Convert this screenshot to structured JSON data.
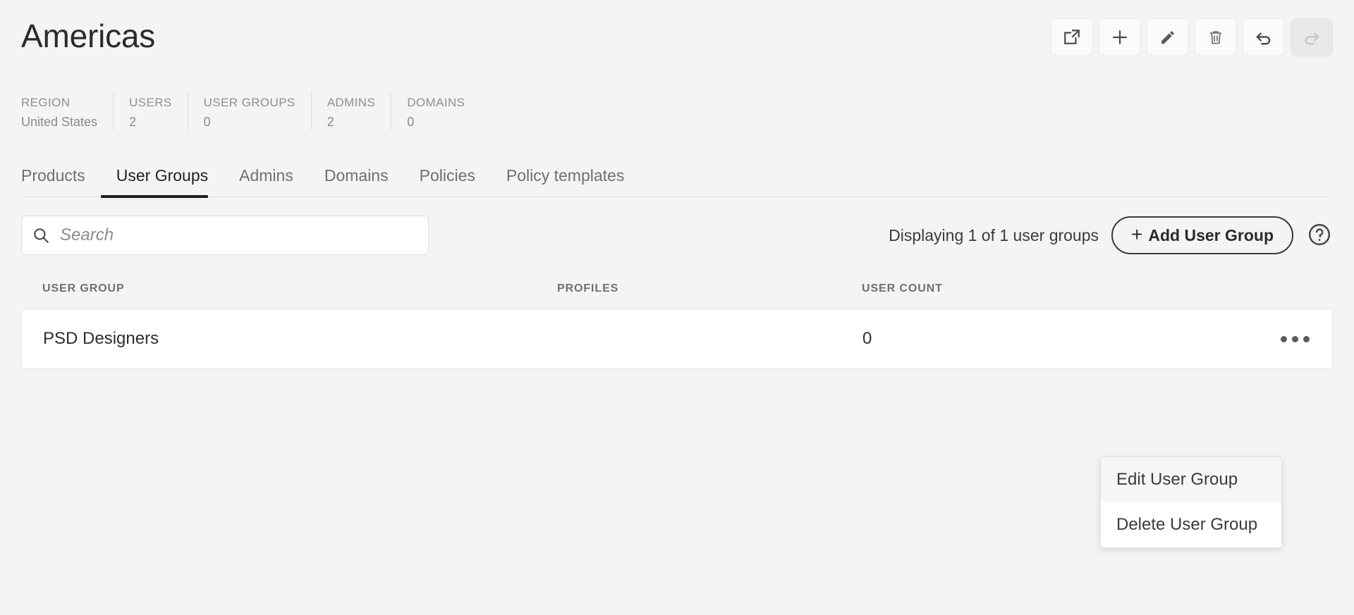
{
  "header": {
    "title": "Americas",
    "toolbar": [
      {
        "name": "open-external-button",
        "icon": "external-link-icon",
        "disabled": false
      },
      {
        "name": "add-button",
        "icon": "plus-icon",
        "disabled": false
      },
      {
        "name": "edit-button",
        "icon": "pencil-icon",
        "disabled": false
      },
      {
        "name": "delete-button",
        "icon": "trash-icon",
        "disabled": false
      },
      {
        "name": "undo-button",
        "icon": "undo-arrow-icon",
        "disabled": false
      },
      {
        "name": "redo-button",
        "icon": "redo-arrow-icon",
        "disabled": true
      }
    ]
  },
  "stats": [
    {
      "label": "REGION",
      "value": "United States"
    },
    {
      "label": "USERS",
      "value": "2"
    },
    {
      "label": "USER GROUPS",
      "value": "0"
    },
    {
      "label": "ADMINS",
      "value": "2"
    },
    {
      "label": "DOMAINS",
      "value": "0"
    }
  ],
  "tabs": [
    {
      "label": "Products",
      "active": false
    },
    {
      "label": "User Groups",
      "active": true
    },
    {
      "label": "Admins",
      "active": false
    },
    {
      "label": "Domains",
      "active": false
    },
    {
      "label": "Policies",
      "active": false
    },
    {
      "label": "Policy templates",
      "active": false
    }
  ],
  "list_toolbar": {
    "search_placeholder": "Search",
    "search_value": "",
    "display_count": "Displaying 1 of 1 user groups",
    "add_button_label": "Add User Group",
    "add_button_plus": "+",
    "help_label": "?"
  },
  "table": {
    "columns": [
      "USER GROUP",
      "PROFILES",
      "USER COUNT"
    ],
    "rows": [
      {
        "user_group": "PSD Designers",
        "profiles": "",
        "user_count": "0"
      }
    ]
  },
  "context_menu": {
    "items": [
      {
        "label": "Edit User Group",
        "highlighted": true
      },
      {
        "label": "Delete User Group",
        "highlighted": false
      }
    ]
  },
  "colors": {
    "page_background": "#f4f4f4",
    "card_background": "#ffffff",
    "text_primary": "#2c2c2c",
    "text_muted": "#8f8f8f",
    "border": "#e3e3e3",
    "active_tab_underline": "#1f1f1f"
  }
}
